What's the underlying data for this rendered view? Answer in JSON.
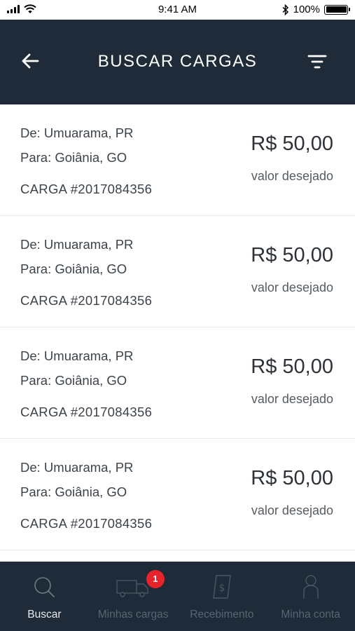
{
  "status_bar": {
    "time": "9:41 AM",
    "battery": "100%"
  },
  "header": {
    "title": "BUSCAR CARGAS"
  },
  "cargas": [
    {
      "from": "De: Umuarama, PR",
      "to": "Para: Goiânia, GO",
      "id": "CARGA #2017084356",
      "price": "R$ 50,00",
      "price_note": "valor desejado"
    },
    {
      "from": "De: Umuarama, PR",
      "to": "Para: Goiânia, GO",
      "id": "CARGA #2017084356",
      "price": "R$ 50,00",
      "price_note": "valor desejado"
    },
    {
      "from": "De: Umuarama, PR",
      "to": "Para: Goiânia, GO",
      "id": "CARGA #2017084356",
      "price": "R$ 50,00",
      "price_note": "valor desejado"
    },
    {
      "from": "De: Umuarama, PR",
      "to": "Para: Goiânia, GO",
      "id": "CARGA #2017084356",
      "price": "R$ 50,00",
      "price_note": "valor desejado"
    }
  ],
  "tabbar": {
    "tabs": [
      {
        "label": "Buscar",
        "icon": "search-icon"
      },
      {
        "label": "Minhas cargas",
        "icon": "truck-icon",
        "badge": "1"
      },
      {
        "label": "Recebimento",
        "icon": "receipt-icon"
      },
      {
        "label": "Minha conta",
        "icon": "user-icon"
      }
    ]
  },
  "colors": {
    "header_bg": "#1f2b38",
    "badge": "#e8232b",
    "tab_inactive": "#596573",
    "tab_active": "#e8ebee"
  }
}
